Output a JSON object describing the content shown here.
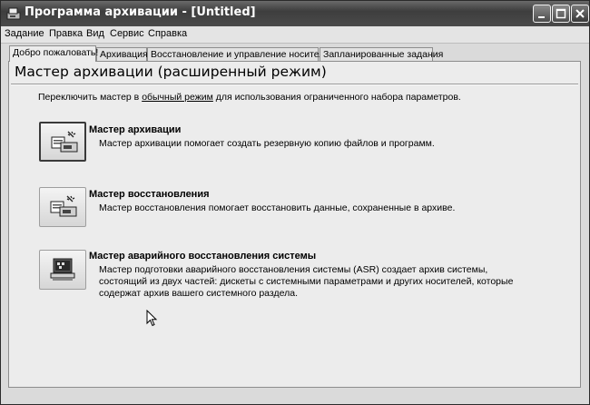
{
  "window": {
    "title": "Программа архивации - [Untitled]",
    "colors": {
      "titlebar": "#4a4a4a",
      "panel": "#ececec"
    }
  },
  "menu": [
    "Задание",
    "Правка",
    "Вид",
    "Сервис",
    "Справка"
  ],
  "tabs": [
    {
      "label": "Добро пожаловать!",
      "active": true
    },
    {
      "label": "Архивация",
      "active": false
    },
    {
      "label": "Восстановление и управление носителем",
      "active": false
    },
    {
      "label": "Запланированные задания",
      "active": false
    }
  ],
  "main": {
    "heading": "Мастер архивации (расширенный режим)",
    "switch_prefix": "Переключить мастер в ",
    "switch_link": "обычный режим",
    "switch_suffix": " для использования ограниченного набора параметров."
  },
  "wizards": [
    {
      "icon": "backup-wizard-icon",
      "title": "Мастер архивации",
      "desc": [
        "Мастер архивации помогает создать резервную копию файлов и программ."
      ]
    },
    {
      "icon": "restore-wizard-icon",
      "title": "Мастер восстановления",
      "desc": [
        "Мастер восстановления помогает восстановить данные, сохраненные в архиве."
      ]
    },
    {
      "icon": "asr-wizard-icon",
      "title": "Мастер аварийного восстановления системы",
      "desc": [
        "Мастер подготовки аварийного восстановления системы (ASR) создает архив системы,",
        "состоящий из двух частей: дискеты с системными параметрами и других носителей, которые",
        "содержат архив вашего системного раздела."
      ]
    }
  ]
}
